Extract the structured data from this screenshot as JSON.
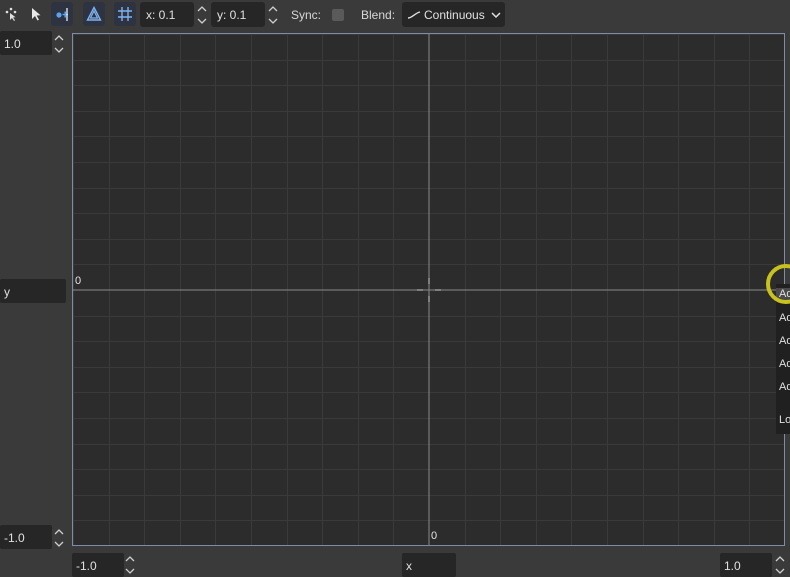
{
  "toolbar": {
    "x_spin": "x: 0.1",
    "y_spin": "y: 0.1",
    "sync_label": "Sync:",
    "blend_label": "Blend:",
    "blend_value": "Continuous",
    "icons": [
      "points-select-icon",
      "select-arrow-icon",
      "add-point-icon",
      "snap-icon",
      "grid-snap-icon"
    ]
  },
  "left": {
    "y_max": "1.0",
    "y_label": "y",
    "y_min": "-1.0"
  },
  "canvas": {
    "origin_left_label": "0",
    "origin_bottom_label": "0"
  },
  "bottom": {
    "x_min": "-1.0",
    "x_label": "x",
    "x_max": "1.0"
  },
  "menu": {
    "items": [
      "Ad",
      "Ad",
      "Ad",
      "Ad",
      "Ad",
      "Lo"
    ]
  },
  "colors": {
    "background": "#3a3a3a",
    "canvas": "#2c2c2c",
    "field": "#262626",
    "cursor_highlight": "#c8c21e",
    "canvas_border": "#7d8da8"
  }
}
